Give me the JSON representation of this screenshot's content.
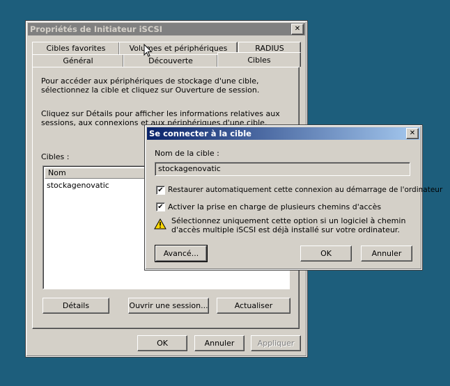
{
  "main_window": {
    "title": "Propriétés de Initiateur iSCSI",
    "close": "✕",
    "tabs_back": [
      "Cibles favorites",
      "Volumes et périphériques",
      "RADIUS"
    ],
    "tabs_front": [
      "Général",
      "Découverte",
      "Cibles"
    ],
    "intro_text_1": "Pour accéder aux périphériques de stockage d'une cible, sélectionnez la cible et cliquez sur Ouverture de session.",
    "intro_text_2": "Cliquez sur Détails pour afficher les informations relatives aux sessions, aux connexions et aux périphériques d'une cible.",
    "targets_label": "Cibles :",
    "list_column": "Nom",
    "list_items": [
      "stockagenovatic"
    ],
    "btn_details": "Détails",
    "btn_open_session": "Ouvrir une session...",
    "btn_refresh": "Actualiser",
    "btn_ok": "OK",
    "btn_cancel": "Annuler",
    "btn_apply": "Appliquer"
  },
  "dialog": {
    "title": "Se connecter à la cible",
    "close": "✕",
    "target_name_label": "Nom de la cible :",
    "target_name_value": "stockagenovatic",
    "chk_restore": "Restaurer automatiquement cette connexion au démarrage de l'ordinateur",
    "chk_multipath": "Activer la prise en charge de plusieurs chemins d'accès",
    "chk_mark": "✔",
    "warning_text": "Sélectionnez uniquement cette option si un logiciel à chemin d'accès multiple iSCSI est déjà installé sur votre ordinateur.",
    "btn_advanced": "Avancé...",
    "btn_ok": "OK",
    "btn_cancel": "Annuler"
  }
}
